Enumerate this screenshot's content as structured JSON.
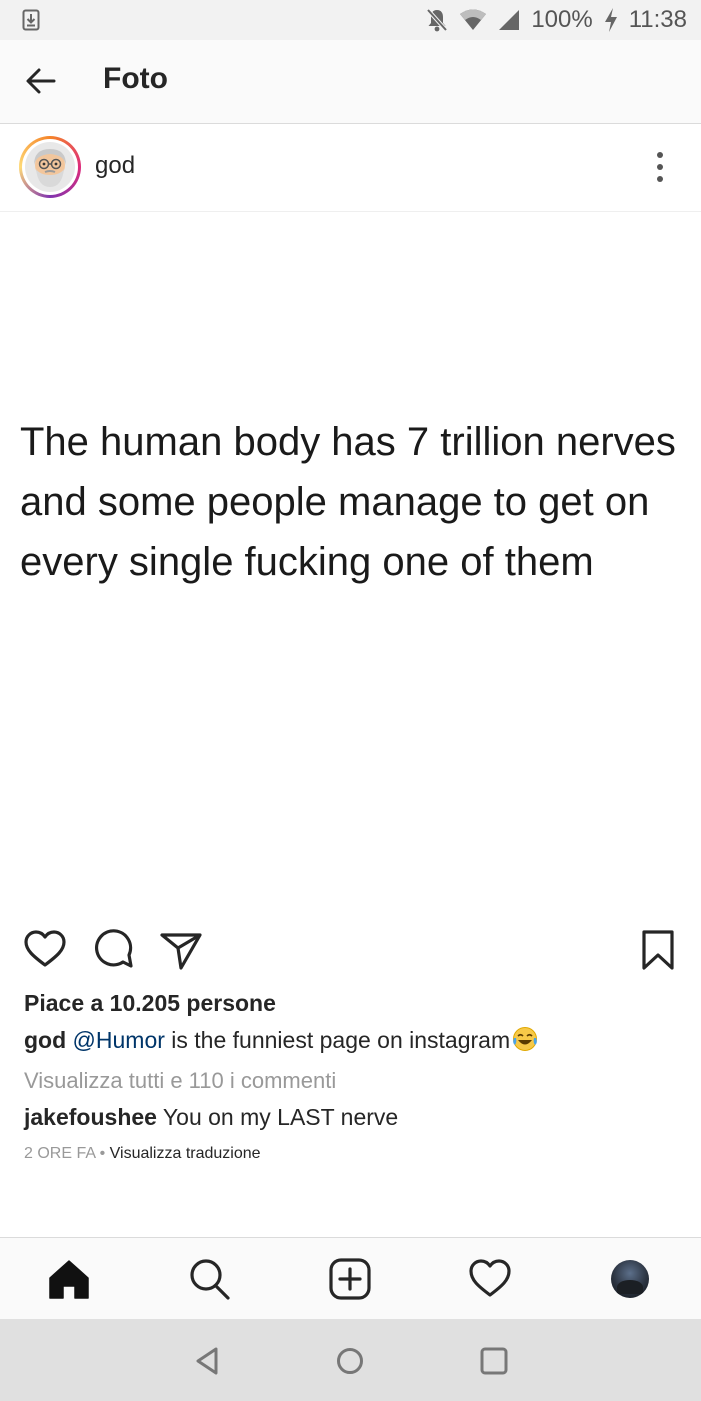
{
  "status_bar": {
    "battery": "100%",
    "time": "11:38",
    "icons": [
      "download-icon",
      "bell-off-icon",
      "wifi-icon",
      "cell-signal-icon",
      "charging-icon"
    ]
  },
  "header": {
    "title": "Foto",
    "back_icon": "arrow-left-icon"
  },
  "post": {
    "username": "god",
    "avatar": "old-man-emoji-avatar",
    "image_text": "The human body has 7 trillion nerves and some people manage to get on every single fucking one of them",
    "likes": "Piace a 10.205 persone",
    "caption": {
      "user": "god",
      "mention": "@Humor",
      "text": " is the funniest page on instagram",
      "emoji": "tears-of-joy-emoji"
    },
    "view_comments": "Visualizza tutti e 110 i commenti",
    "comment": {
      "user": "jakefoushee",
      "text": " You on my LAST nerve"
    },
    "time_ago": "2 ORE FA",
    "separator": " • ",
    "translate": "Visualizza traduzione",
    "actions": [
      "heart-icon",
      "comment-icon",
      "share-icon",
      "bookmark-icon"
    ]
  },
  "bottom_nav": [
    "home-icon",
    "search-icon",
    "add-post-icon",
    "activity-heart-icon",
    "profile-avatar"
  ],
  "system_nav": [
    "back-triangle-icon",
    "home-circle-icon",
    "recents-square-icon"
  ],
  "colors": {
    "mention": "#003569",
    "secondary_text": "#999999",
    "primary_text": "#262626",
    "header_bg": "#fafafa",
    "system_nav_bg": "#e0e0e0"
  }
}
